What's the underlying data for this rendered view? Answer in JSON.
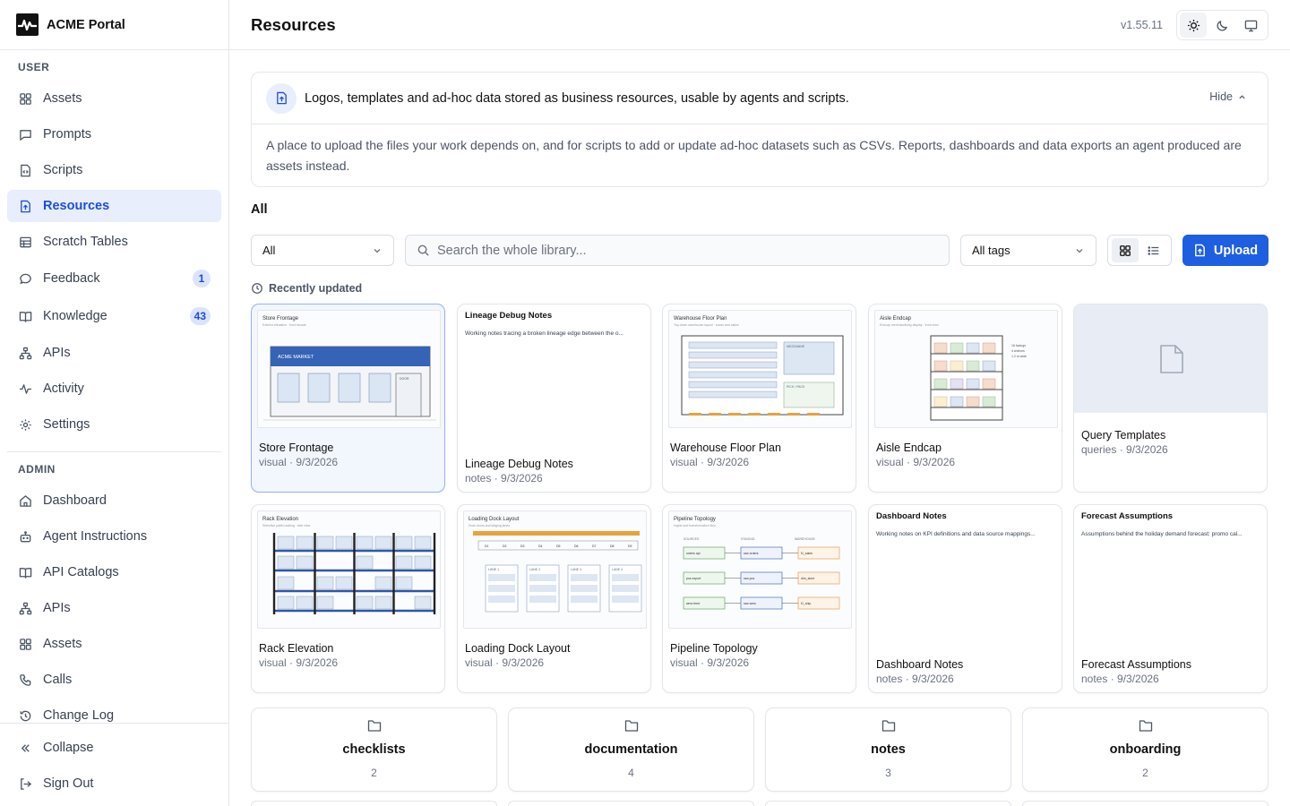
{
  "brand": {
    "title": "ACME Portal"
  },
  "sidebar": {
    "user_label": "USER",
    "user_items": [
      {
        "label": "Assets",
        "icon": "grid-icon"
      },
      {
        "label": "Prompts",
        "icon": "message-square-icon"
      },
      {
        "label": "Scripts",
        "icon": "code-file-icon"
      },
      {
        "label": "Resources",
        "icon": "file-upload-icon",
        "active": true
      },
      {
        "label": "Scratch Tables",
        "icon": "table-icon"
      },
      {
        "label": "Feedback",
        "icon": "chat-bubble-icon",
        "badge": "1"
      },
      {
        "label": "Knowledge",
        "icon": "book-open-icon",
        "badge": "43"
      },
      {
        "label": "APIs",
        "icon": "network-icon"
      },
      {
        "label": "Activity",
        "icon": "pulse-icon"
      },
      {
        "label": "Settings",
        "icon": "gear-icon"
      }
    ],
    "admin_label": "ADMIN",
    "admin_items": [
      {
        "label": "Dashboard",
        "icon": "home-icon"
      },
      {
        "label": "Agent Instructions",
        "icon": "bot-icon"
      },
      {
        "label": "API Catalogs",
        "icon": "book-open-icon"
      },
      {
        "label": "APIs",
        "icon": "network-icon"
      },
      {
        "label": "Assets",
        "icon": "grid-icon"
      },
      {
        "label": "Calls",
        "icon": "phone-icon"
      },
      {
        "label": "Change Log",
        "icon": "history-icon"
      }
    ],
    "collapse_label": "Collapse",
    "signout_label": "Sign Out"
  },
  "header": {
    "title": "Resources",
    "version": "v1.55.11",
    "theme_options": [
      "light",
      "dark",
      "system"
    ],
    "active_theme": "light"
  },
  "info": {
    "summary": "Logos, templates and ad-hoc data stored as business resources, usable by agents and scripts.",
    "hide_label": "Hide",
    "body": "A place to upload the files your work depends on, and for scripts to add or update ad-hoc datasets such as CSVs. Reports, dashboards and data exports an agent produced are assets instead."
  },
  "filter_heading": "All",
  "toolbar": {
    "type_filter": "All",
    "search_placeholder": "Search the whole library...",
    "tag_filter": "All tags",
    "view_mode": "grid",
    "upload_label": "Upload"
  },
  "recent_label": "Recently updated",
  "cards": [
    {
      "name": "Store Frontage",
      "meta": "visual · 9/3/2026",
      "kind": "visual",
      "thumb_title": "Store Frontage",
      "thumb_subtitle": "Exterior elevation · front facade",
      "thumb_sign": "ACME MARKET",
      "thumb_door": "DOOR",
      "selected": true
    },
    {
      "name": "Lineage Debug Notes",
      "meta": "notes · 9/3/2026",
      "kind": "notes",
      "note_title": "Lineage Debug Notes",
      "note_body": "Working notes tracing a broken lineage edge between the o..."
    },
    {
      "name": "Warehouse Floor Plan",
      "meta": "visual · 9/3/2026",
      "kind": "visual",
      "thumb_title": "Warehouse Floor Plan",
      "thumb_subtitle": "Top-down warehouse layout · zones and aisles",
      "thumb_labels": [
        "MEZZANINE",
        "PICK / PACK"
      ]
    },
    {
      "name": "Aisle Endcap",
      "meta": "visual · 9/3/2026",
      "kind": "visual",
      "thumb_title": "Aisle Endcap",
      "thumb_subtitle": "Endcap merchandising display · front view",
      "thumb_labels": [
        "16 facings",
        "4 shelves",
        "1.2 m wide"
      ]
    },
    {
      "name": "Query Templates",
      "meta": "queries · 9/3/2026",
      "kind": "queries"
    },
    {
      "name": "Rack Elevation",
      "meta": "visual · 9/3/2026",
      "kind": "visual",
      "thumb_title": "Rack Elevation",
      "thumb_subtitle": "Selective pallet racking · side view"
    },
    {
      "name": "Loading Dock Layout",
      "meta": "visual · 9/3/2026",
      "kind": "visual",
      "thumb_title": "Loading Dock Layout",
      "thumb_subtitle": "Dock doors and staging lanes",
      "thumb_doors": [
        "D1",
        "D2",
        "D3",
        "D4",
        "D5",
        "D6",
        "D7",
        "D8",
        "D9"
      ],
      "thumb_lanes": [
        "LANE 1",
        "LANE 2",
        "LANE 3",
        "LANE 4"
      ]
    },
    {
      "name": "Pipeline Topology",
      "meta": "visual · 9/3/2026",
      "kind": "visual",
      "thumb_title": "Pipeline Topology",
      "thumb_subtitle": "Ingest and transformation flow",
      "thumb_cols": [
        "SOURCES",
        "STAGING",
        "WAREHOUSE"
      ],
      "thumb_nodes": [
        [
          "orders api",
          "raw orders",
          "f1_sales"
        ],
        [
          "pos export",
          "raw pos",
          "dim_store"
        ],
        [
          "wms feed",
          "raw wms",
          "f1_ship"
        ]
      ]
    },
    {
      "name": "Dashboard Notes",
      "meta": "notes · 9/3/2026",
      "kind": "notes",
      "note_title": "Dashboard Notes",
      "note_body": "Working notes on KPI definitions and data source mappings..."
    },
    {
      "name": "Forecast Assumptions",
      "meta": "notes · 9/3/2026",
      "kind": "notes",
      "note_title": "Forecast Assumptions",
      "note_body": "Assumptions behind the holiday demand forecast: promo cal..."
    }
  ],
  "folders": [
    {
      "name": "checklists",
      "count": "2"
    },
    {
      "name": "documentation",
      "count": "4"
    },
    {
      "name": "notes",
      "count": "3"
    },
    {
      "name": "onboarding",
      "count": "2"
    }
  ],
  "colors": {
    "accent": "#1d5fe0",
    "active_bg": "#e8eefb",
    "border": "#e5e7eb"
  }
}
